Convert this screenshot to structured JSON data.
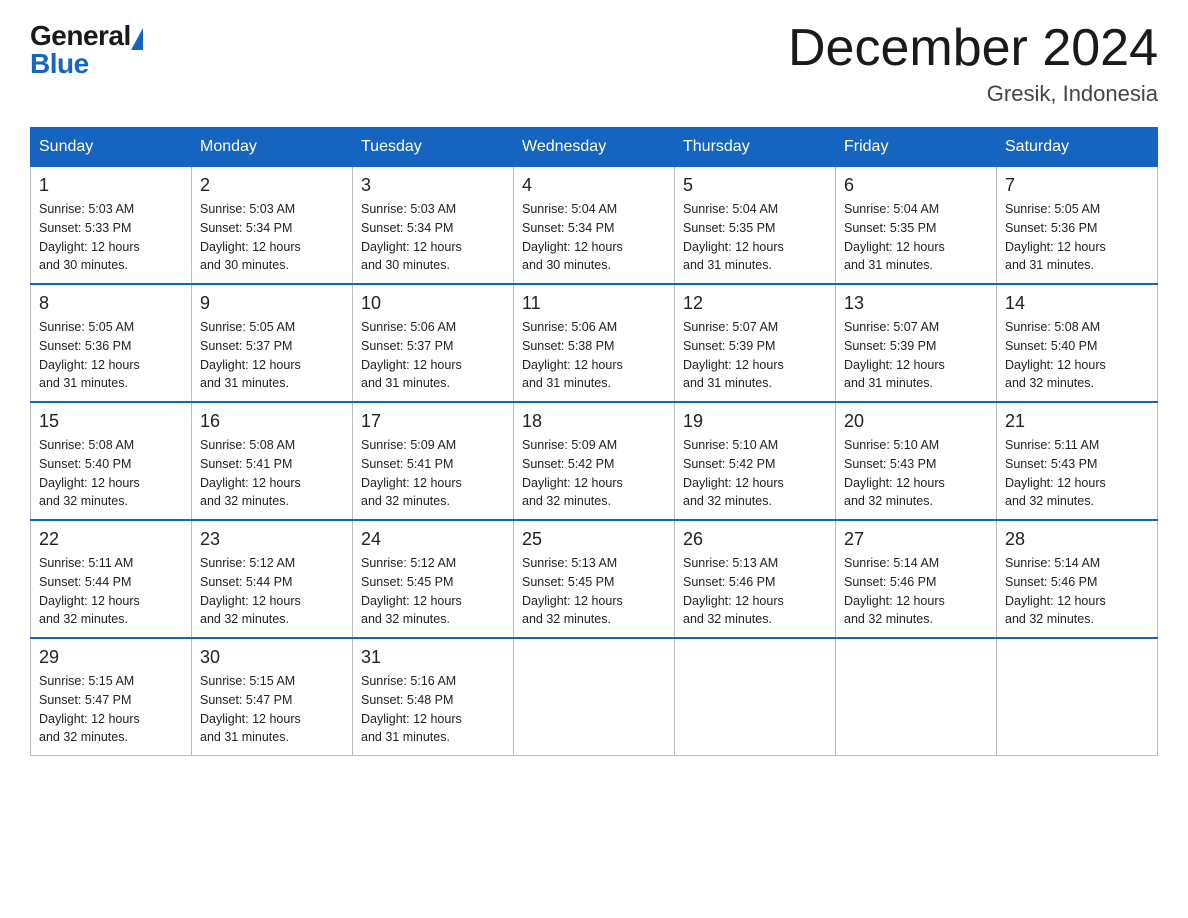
{
  "header": {
    "logo_general": "General",
    "logo_blue": "Blue",
    "month_title": "December 2024",
    "location": "Gresik, Indonesia"
  },
  "calendar": {
    "days_of_week": [
      "Sunday",
      "Monday",
      "Tuesday",
      "Wednesday",
      "Thursday",
      "Friday",
      "Saturday"
    ],
    "weeks": [
      [
        {
          "day": "1",
          "sunrise": "5:03 AM",
          "sunset": "5:33 PM",
          "daylight": "12 hours and 30 minutes."
        },
        {
          "day": "2",
          "sunrise": "5:03 AM",
          "sunset": "5:34 PM",
          "daylight": "12 hours and 30 minutes."
        },
        {
          "day": "3",
          "sunrise": "5:03 AM",
          "sunset": "5:34 PM",
          "daylight": "12 hours and 30 minutes."
        },
        {
          "day": "4",
          "sunrise": "5:04 AM",
          "sunset": "5:34 PM",
          "daylight": "12 hours and 30 minutes."
        },
        {
          "day": "5",
          "sunrise": "5:04 AM",
          "sunset": "5:35 PM",
          "daylight": "12 hours and 31 minutes."
        },
        {
          "day": "6",
          "sunrise": "5:04 AM",
          "sunset": "5:35 PM",
          "daylight": "12 hours and 31 minutes."
        },
        {
          "day": "7",
          "sunrise": "5:05 AM",
          "sunset": "5:36 PM",
          "daylight": "12 hours and 31 minutes."
        }
      ],
      [
        {
          "day": "8",
          "sunrise": "5:05 AM",
          "sunset": "5:36 PM",
          "daylight": "12 hours and 31 minutes."
        },
        {
          "day": "9",
          "sunrise": "5:05 AM",
          "sunset": "5:37 PM",
          "daylight": "12 hours and 31 minutes."
        },
        {
          "day": "10",
          "sunrise": "5:06 AM",
          "sunset": "5:37 PM",
          "daylight": "12 hours and 31 minutes."
        },
        {
          "day": "11",
          "sunrise": "5:06 AM",
          "sunset": "5:38 PM",
          "daylight": "12 hours and 31 minutes."
        },
        {
          "day": "12",
          "sunrise": "5:07 AM",
          "sunset": "5:39 PM",
          "daylight": "12 hours and 31 minutes."
        },
        {
          "day": "13",
          "sunrise": "5:07 AM",
          "sunset": "5:39 PM",
          "daylight": "12 hours and 31 minutes."
        },
        {
          "day": "14",
          "sunrise": "5:08 AM",
          "sunset": "5:40 PM",
          "daylight": "12 hours and 32 minutes."
        }
      ],
      [
        {
          "day": "15",
          "sunrise": "5:08 AM",
          "sunset": "5:40 PM",
          "daylight": "12 hours and 32 minutes."
        },
        {
          "day": "16",
          "sunrise": "5:08 AM",
          "sunset": "5:41 PM",
          "daylight": "12 hours and 32 minutes."
        },
        {
          "day": "17",
          "sunrise": "5:09 AM",
          "sunset": "5:41 PM",
          "daylight": "12 hours and 32 minutes."
        },
        {
          "day": "18",
          "sunrise": "5:09 AM",
          "sunset": "5:42 PM",
          "daylight": "12 hours and 32 minutes."
        },
        {
          "day": "19",
          "sunrise": "5:10 AM",
          "sunset": "5:42 PM",
          "daylight": "12 hours and 32 minutes."
        },
        {
          "day": "20",
          "sunrise": "5:10 AM",
          "sunset": "5:43 PM",
          "daylight": "12 hours and 32 minutes."
        },
        {
          "day": "21",
          "sunrise": "5:11 AM",
          "sunset": "5:43 PM",
          "daylight": "12 hours and 32 minutes."
        }
      ],
      [
        {
          "day": "22",
          "sunrise": "5:11 AM",
          "sunset": "5:44 PM",
          "daylight": "12 hours and 32 minutes."
        },
        {
          "day": "23",
          "sunrise": "5:12 AM",
          "sunset": "5:44 PM",
          "daylight": "12 hours and 32 minutes."
        },
        {
          "day": "24",
          "sunrise": "5:12 AM",
          "sunset": "5:45 PM",
          "daylight": "12 hours and 32 minutes."
        },
        {
          "day": "25",
          "sunrise": "5:13 AM",
          "sunset": "5:45 PM",
          "daylight": "12 hours and 32 minutes."
        },
        {
          "day": "26",
          "sunrise": "5:13 AM",
          "sunset": "5:46 PM",
          "daylight": "12 hours and 32 minutes."
        },
        {
          "day": "27",
          "sunrise": "5:14 AM",
          "sunset": "5:46 PM",
          "daylight": "12 hours and 32 minutes."
        },
        {
          "day": "28",
          "sunrise": "5:14 AM",
          "sunset": "5:46 PM",
          "daylight": "12 hours and 32 minutes."
        }
      ],
      [
        {
          "day": "29",
          "sunrise": "5:15 AM",
          "sunset": "5:47 PM",
          "daylight": "12 hours and 32 minutes."
        },
        {
          "day": "30",
          "sunrise": "5:15 AM",
          "sunset": "5:47 PM",
          "daylight": "12 hours and 31 minutes."
        },
        {
          "day": "31",
          "sunrise": "5:16 AM",
          "sunset": "5:48 PM",
          "daylight": "12 hours and 31 minutes."
        },
        null,
        null,
        null,
        null
      ]
    ],
    "labels": {
      "sunrise": "Sunrise:",
      "sunset": "Sunset:",
      "daylight": "Daylight:"
    }
  }
}
